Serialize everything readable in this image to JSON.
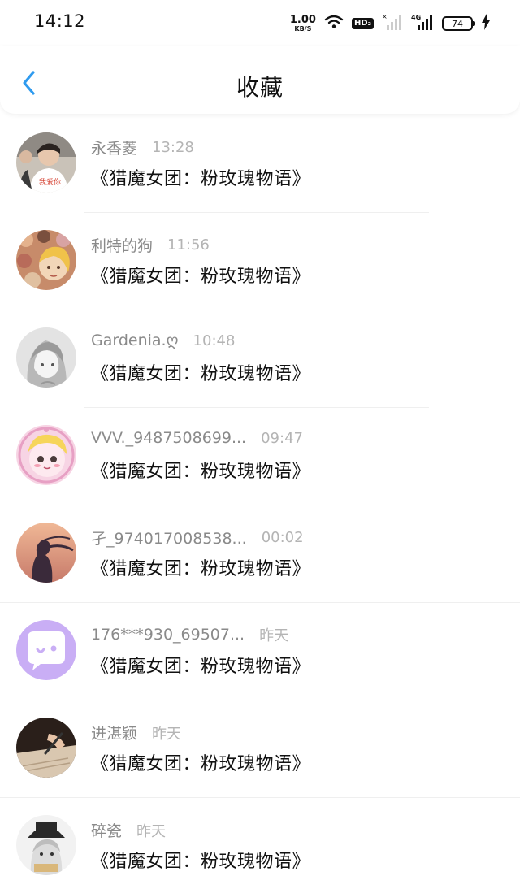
{
  "status": {
    "time": "14:12",
    "net_speed": "1.00",
    "net_unit": "KB/S",
    "hd_label": "HD₂",
    "network": "4G",
    "battery": "74"
  },
  "header": {
    "title": "收藏"
  },
  "items": [
    {
      "user": "永香菱",
      "time": "13:28",
      "title": "《猎魔女团：粉玫瑰物语》"
    },
    {
      "user": "利特的狗",
      "time": "11:56",
      "title": "《猎魔女团：粉玫瑰物语》"
    },
    {
      "user": "Gardenia.ღ",
      "time": "10:48",
      "title": "《猎魔女团：粉玫瑰物语》"
    },
    {
      "user": "VVV._9487508699...",
      "time": "09:47",
      "title": "《猎魔女团：粉玫瑰物语》"
    },
    {
      "user": "孑_974017008538...",
      "time": "00:02",
      "title": "《猎魔女团：粉玫瑰物语》"
    },
    {
      "user": "176***930_69507...",
      "time": "昨天",
      "title": "《猎魔女团：粉玫瑰物语》"
    },
    {
      "user": "进湛颖",
      "time": "昨天",
      "title": "《猎魔女团：粉玫瑰物语》"
    },
    {
      "user": "碎瓷",
      "time": "昨天",
      "title": "《猎魔女团：粉玫瑰物语》"
    }
  ],
  "colors": {
    "accent": "#2f9bef",
    "muted": "#8a8a8a",
    "time": "#b4b4b4"
  }
}
